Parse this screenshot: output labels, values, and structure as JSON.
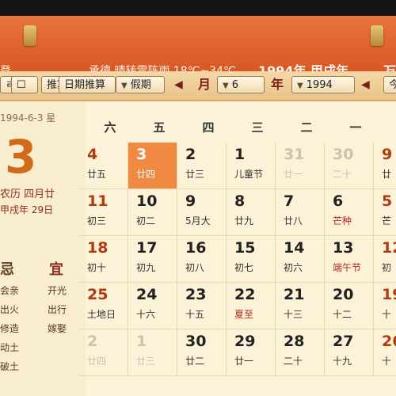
{
  "header": {
    "left_text": "登",
    "weather": "承德 晴转雷阵雨 18℃~34℃",
    "year_title": "1994年 甲戌年",
    "right_text": "万"
  },
  "toolbar": {
    "tool_btn": "ㄹ 设",
    "settings_btn": "☐",
    "calc_btn": "推算",
    "query_btn": "日期推算",
    "holiday_btn": "假期",
    "month_label": "月",
    "month_value": "6",
    "year_label": "年",
    "year_value": "1994",
    "today_btn": "今"
  },
  "side": {
    "date_line": "1994-6-3 星",
    "big_day": "3",
    "lunar_line": "农历 四月廿",
    "ganzhi_line": "甲戌年 29日",
    "yi": "宜",
    "ji": "忌",
    "yi_items": [
      "开光",
      "出行",
      "嫁娶"
    ],
    "ji_items": [
      "会亲",
      "出火",
      "修造",
      "动土",
      "破土"
    ]
  },
  "calendar": {
    "weekdays": [
      "一",
      "二",
      "三",
      "四",
      "五",
      "六"
    ],
    "weeks": [
      [
        {
          "d": "9",
          "l": "廿",
          "cls": "wknd"
        },
        {
          "d": "30",
          "l": "二十",
          "cls": "gray"
        },
        {
          "d": "31",
          "l": "廿一",
          "cls": "gray"
        },
        {
          "d": "1",
          "l": "儿童节",
          "cls": ""
        },
        {
          "d": "2",
          "l": "廿三",
          "cls": ""
        },
        {
          "d": "3",
          "l": "廿四",
          "cls": "today"
        },
        {
          "d": "4",
          "l": "廿五",
          "cls": "wknd"
        }
      ],
      [
        {
          "d": "5",
          "l": "芒",
          "cls": "wknd"
        },
        {
          "d": "6",
          "l": "芒种",
          "cls": "",
          "red": true
        },
        {
          "d": "7",
          "l": "廿八",
          "cls": ""
        },
        {
          "d": "8",
          "l": "廿九",
          "cls": ""
        },
        {
          "d": "9",
          "l": "5月大",
          "cls": ""
        },
        {
          "d": "10",
          "l": "初二",
          "cls": ""
        },
        {
          "d": "11",
          "l": "初三",
          "cls": "wknd"
        }
      ],
      [
        {
          "d": "12",
          "l": "初",
          "cls": "wknd"
        },
        {
          "d": "13",
          "l": "端午节",
          "cls": "",
          "red": true
        },
        {
          "d": "14",
          "l": "初六",
          "cls": ""
        },
        {
          "d": "15",
          "l": "初七",
          "cls": ""
        },
        {
          "d": "16",
          "l": "初八",
          "cls": ""
        },
        {
          "d": "17",
          "l": "初九",
          "cls": ""
        },
        {
          "d": "18",
          "l": "初十",
          "cls": "wknd"
        }
      ],
      [
        {
          "d": "19",
          "l": "十",
          "cls": "wknd"
        },
        {
          "d": "20",
          "l": "十二",
          "cls": ""
        },
        {
          "d": "21",
          "l": "十三",
          "cls": ""
        },
        {
          "d": "22",
          "l": "夏至",
          "cls": "",
          "red": true
        },
        {
          "d": "23",
          "l": "十五",
          "cls": ""
        },
        {
          "d": "24",
          "l": "十六",
          "cls": ""
        },
        {
          "d": "25",
          "l": "土地日",
          "cls": "wknd"
        }
      ],
      [
        {
          "d": "26",
          "l": "十",
          "cls": "wknd"
        },
        {
          "d": "27",
          "l": "十九",
          "cls": ""
        },
        {
          "d": "28",
          "l": "二十",
          "cls": ""
        },
        {
          "d": "29",
          "l": "廿一",
          "cls": ""
        },
        {
          "d": "30",
          "l": "廿二",
          "cls": ""
        },
        {
          "d": "1",
          "l": "廿三",
          "cls": "gray"
        },
        {
          "d": "2",
          "l": "廿四",
          "cls": "gray"
        }
      ]
    ]
  }
}
